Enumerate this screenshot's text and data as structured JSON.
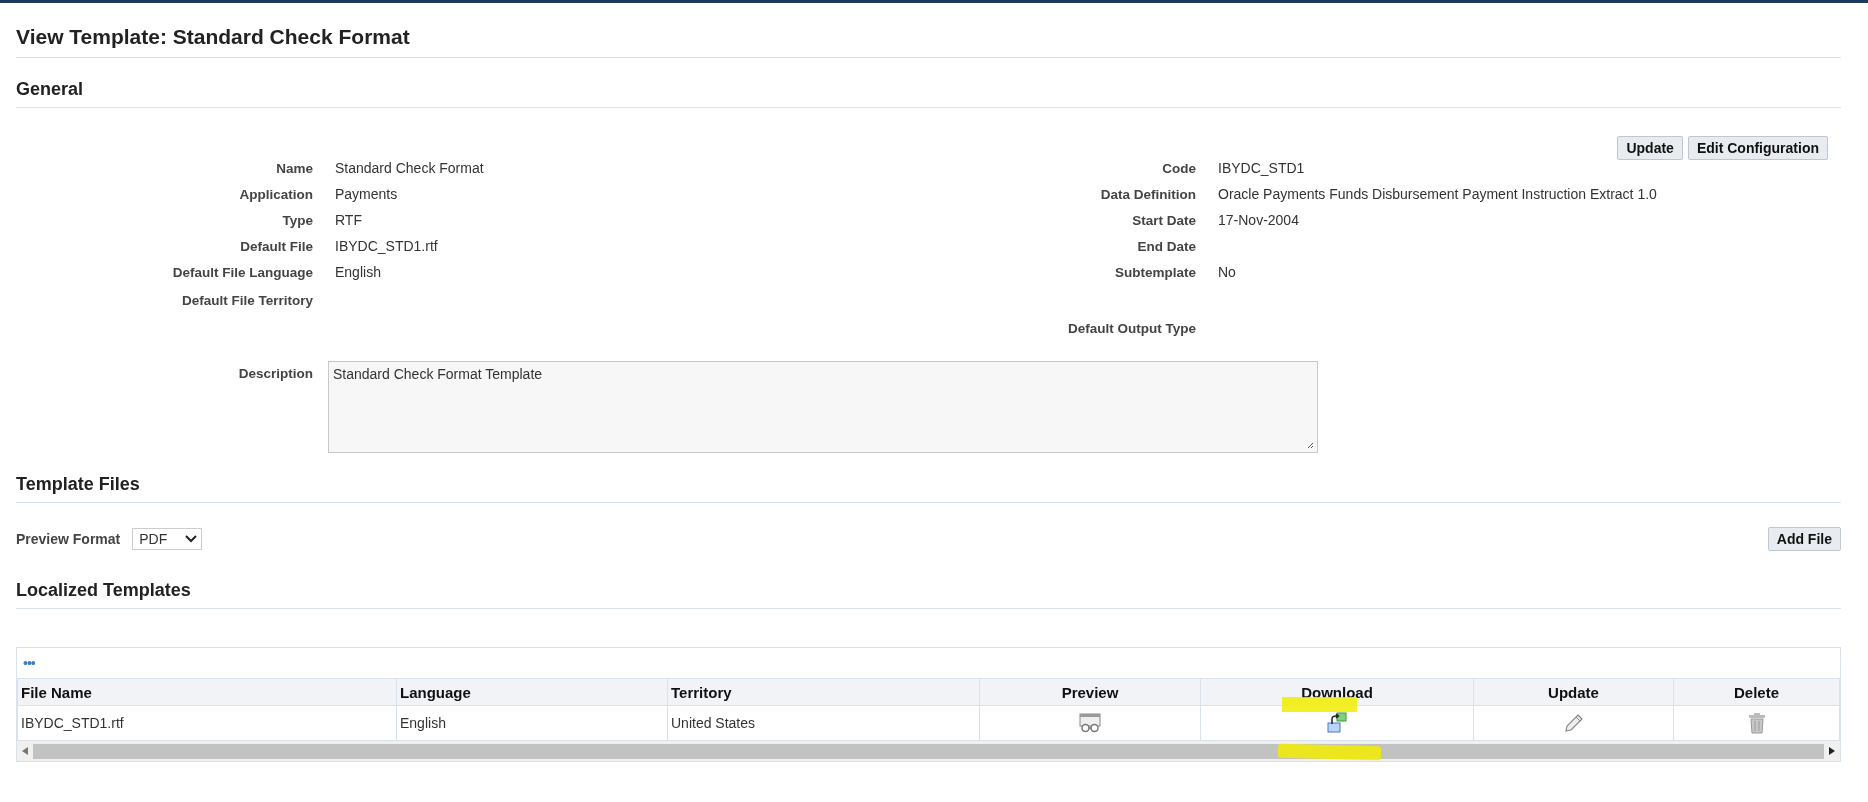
{
  "title": "View Template: Standard Check Format",
  "general": {
    "heading": "General",
    "buttons": [
      "Update",
      "Edit Configuration"
    ],
    "left_fields": [
      {
        "label": "Name",
        "value": "Standard Check Format"
      },
      {
        "label": "Application",
        "value": "Payments"
      },
      {
        "label": "Type",
        "value": "RTF"
      },
      {
        "label": "Default File",
        "value": "IBYDC_STD1.rtf"
      },
      {
        "label": "Default File Language",
        "value": "English"
      },
      {
        "label": "Default File Territory"
      }
    ],
    "right_fields": [
      {
        "label": "Code",
        "value": "IBYDC_STD1"
      },
      {
        "label": "Data Definition",
        "value": "Oracle Payments Funds Disbursement Payment Instruction Extract 1.0"
      },
      {
        "label": "Start Date",
        "value": "17-Nov-2004"
      },
      {
        "label": "End Date"
      },
      {
        "label": "Subtemplate",
        "value": "No"
      },
      {
        "label": "Default Output Type"
      }
    ],
    "description": {
      "label": "Description",
      "value": "Standard Check Format Template"
    }
  },
  "template_files": {
    "heading": "Template Files",
    "preview_format": {
      "label": "Preview Format",
      "value": "PDF"
    },
    "add_button": "Add File"
  },
  "localized": {
    "heading": "Localized Templates",
    "more": "•••",
    "columns": [
      {
        "label": "File Name",
        "kind": "text"
      },
      {
        "label": "Language",
        "kind": "text"
      },
      {
        "label": "Territory",
        "kind": "text"
      },
      {
        "label": "Preview",
        "kind": "preview"
      },
      {
        "label": "Download",
        "kind": "download"
      },
      {
        "label": "Update",
        "kind": "edit"
      },
      {
        "label": "Delete",
        "kind": "delete"
      }
    ],
    "rows": [
      {
        "cells": [
          "IBYDC_STD1.rtf",
          "English",
          "United States"
        ]
      }
    ]
  }
}
